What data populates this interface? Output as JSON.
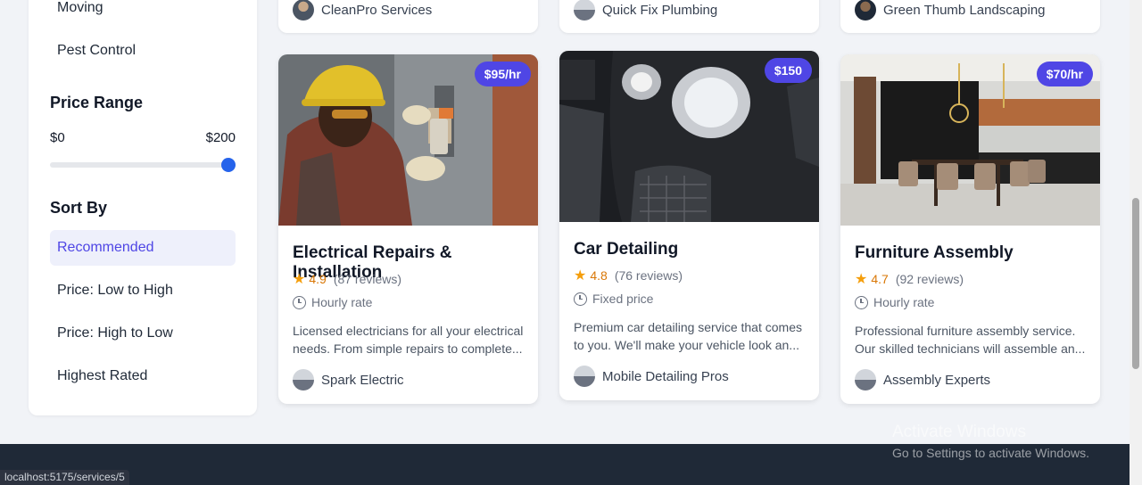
{
  "sidebar": {
    "categories": [
      "Moving",
      "Pest Control"
    ],
    "price_range": {
      "title": "Price Range",
      "min_label": "$0",
      "max_label": "$200",
      "slider_fraction": 1.0
    },
    "sort": {
      "title": "Sort By",
      "options": [
        "Recommended",
        "Price: Low to High",
        "Price: High to Low",
        "Highest Rated"
      ],
      "selected": "Recommended"
    }
  },
  "top_providers": [
    "CleanPro Services",
    "Quick Fix Plumbing",
    "Green Thumb Landscaping"
  ],
  "cards": [
    {
      "title": "Electrical Repairs & Installation",
      "price": "$95/hr",
      "rating": "4.9",
      "reviews": "(87 reviews)",
      "price_type": "Hourly rate",
      "description": "Licensed electricians for all your electrical needs. From simple repairs to complete...",
      "provider": "Spark Electric"
    },
    {
      "title": "Car Detailing",
      "price": "$150",
      "rating": "4.8",
      "reviews": "(76 reviews)",
      "price_type": "Fixed price",
      "description": "Premium car detailing service that comes to you. We'll make your vehicle look an...",
      "provider": "Mobile Detailing Pros"
    },
    {
      "title": "Furniture Assembly",
      "price": "$70/hr",
      "rating": "4.7",
      "reviews": "(92 reviews)",
      "price_type": "Hourly rate",
      "description": "Professional furniture assembly service. Our skilled technicians will assemble an...",
      "provider": "Assembly Experts"
    }
  ],
  "status_url": "localhost:5175/services/5",
  "watermark": {
    "line1": "Activate Windows",
    "line2": "Go to Settings to activate Windows."
  },
  "colors": {
    "accent": "#4f46e5",
    "star": "#f59e0b",
    "footer": "#1f2937"
  },
  "icons": {
    "rating": "star-icon",
    "price_type": "clock-icon"
  }
}
